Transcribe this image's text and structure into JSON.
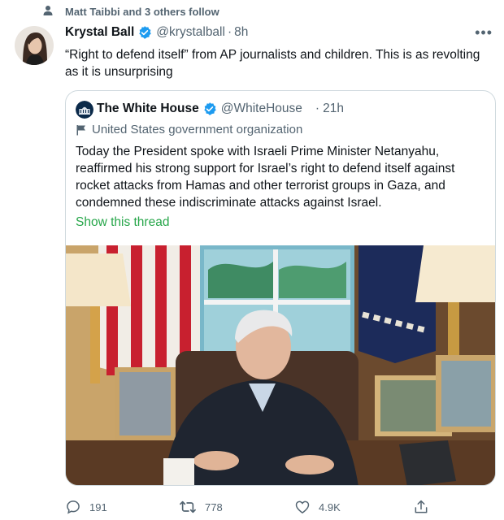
{
  "social_context": "Matt Taibbi and 3 others follow",
  "tweet": {
    "display_name": "Krystal Ball",
    "handle": "@krystalball",
    "separator": "·",
    "time": "8h",
    "text": "“Right to defend itself” from AP journalists and children. This is as revolting as it is unsurprising"
  },
  "quoted": {
    "display_name": "The White House",
    "handle": "@WhiteHouse",
    "separator": "·",
    "time": "21h",
    "label": "United States government organization",
    "text": "Today the President spoke with Israeli Prime Minister Netanyahu, reaffirmed his strong support for Israel’s right to defend itself against rocket attacks from Hamas and other terrorist groups in Gaza, and condemned these indiscriminate attacks against Israel.",
    "show_thread": "Show this thread"
  },
  "actions": {
    "replies": "191",
    "retweets": "778",
    "likes": "4.9K"
  },
  "colors": {
    "verified": "#1d9bf0",
    "link": "#27a64a",
    "secondary": "#536471",
    "border": "#cfd9de"
  }
}
